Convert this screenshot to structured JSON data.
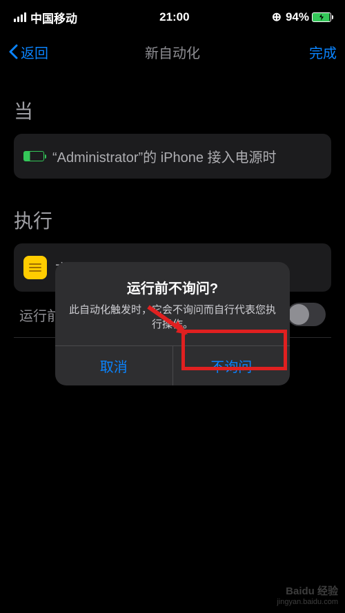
{
  "statusBar": {
    "carrier": "中国移动",
    "time": "21:00",
    "battery": "94%"
  },
  "nav": {
    "back": "返回",
    "title": "新自动化",
    "done": "完成"
  },
  "sections": {
    "when": "当",
    "do": "执行"
  },
  "trigger": {
    "text": "“Administrator”的 iPhone 接入电源时"
  },
  "action": {
    "label": "文"
  },
  "toggle": {
    "label": "运行前询问"
  },
  "alert": {
    "title": "运行前不询问?",
    "message": "此自动化触发时，它会不询问而自行代表您执行操作。",
    "cancel": "取消",
    "confirm": "不询问"
  },
  "watermark": {
    "brand": "Baidu 经验",
    "url": "jingyan.baidu.com"
  }
}
